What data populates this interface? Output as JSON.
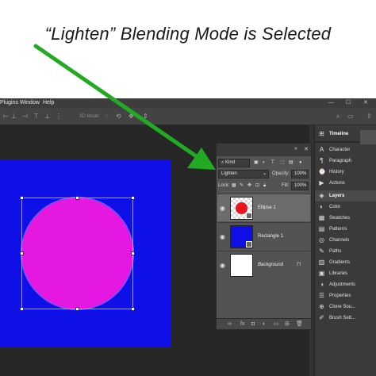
{
  "caption": "“Lighten” Blending Mode is Selected",
  "menubar": {
    "items": [
      "Plugins",
      "Window",
      "Help"
    ],
    "window_controls": [
      "—",
      "☐",
      "✕"
    ]
  },
  "options_bar": {
    "mode_label": "3D Mode:"
  },
  "layers_panel": {
    "kind_label": "Kind",
    "blend_mode": "Lighten",
    "opacity_label": "Opacity:",
    "opacity_value": "100%",
    "lock_label": "Lock:",
    "fill_label": "Fill:",
    "fill_value": "100%",
    "layers": [
      {
        "name": "Ellipse 1",
        "selected": true,
        "italic": false
      },
      {
        "name": "Rectangle 1",
        "selected": false,
        "italic": false
      },
      {
        "name": "Background",
        "selected": false,
        "italic": true
      }
    ]
  },
  "right_dock": {
    "items": [
      {
        "label": "Timeline",
        "icon": "timeline-icon",
        "glyph": "⊞",
        "bold": true
      },
      {
        "label": "Character",
        "icon": "character-icon",
        "glyph": "A",
        "bold": false
      },
      {
        "label": "Paragraph",
        "icon": "paragraph-icon",
        "glyph": "¶",
        "bold": false
      },
      {
        "label": "History",
        "icon": "history-icon",
        "glyph": "⌚",
        "bold": false
      },
      {
        "label": "Actions",
        "icon": "actions-icon",
        "glyph": "▶",
        "bold": false
      },
      {
        "label": "Layers",
        "icon": "layers-icon",
        "glyph": "◈",
        "bold": true
      },
      {
        "label": "Color",
        "icon": "color-icon",
        "glyph": "◐",
        "bold": false
      },
      {
        "label": "Swatches",
        "icon": "swatches-icon",
        "glyph": "▦",
        "bold": false
      },
      {
        "label": "Patterns",
        "icon": "patterns-icon",
        "glyph": "▤",
        "bold": false
      },
      {
        "label": "Channels",
        "icon": "channels-icon",
        "glyph": "◎",
        "bold": false
      },
      {
        "label": "Paths",
        "icon": "paths-icon",
        "glyph": "✎",
        "bold": false
      },
      {
        "label": "Gradients",
        "icon": "gradients-icon",
        "glyph": "▥",
        "bold": false
      },
      {
        "label": "Libraries",
        "icon": "libraries-icon",
        "glyph": "▣",
        "bold": false
      },
      {
        "label": "Adjustments",
        "icon": "adjustments-icon",
        "glyph": "◑",
        "bold": false
      },
      {
        "label": "Properties",
        "icon": "properties-icon",
        "glyph": "☰",
        "bold": false
      },
      {
        "label": "Clone Sou...",
        "icon": "clone-source-icon",
        "glyph": "⊕",
        "bold": false
      },
      {
        "label": "Brush Sett...",
        "icon": "brush-settings-icon",
        "glyph": "✐",
        "bold": false
      }
    ]
  },
  "colors": {
    "arrow": "#22aa22",
    "document_bg": "#0f10e8",
    "ellipse_fill": "#e418e0",
    "ellipse_thumb": "#e8141e"
  }
}
